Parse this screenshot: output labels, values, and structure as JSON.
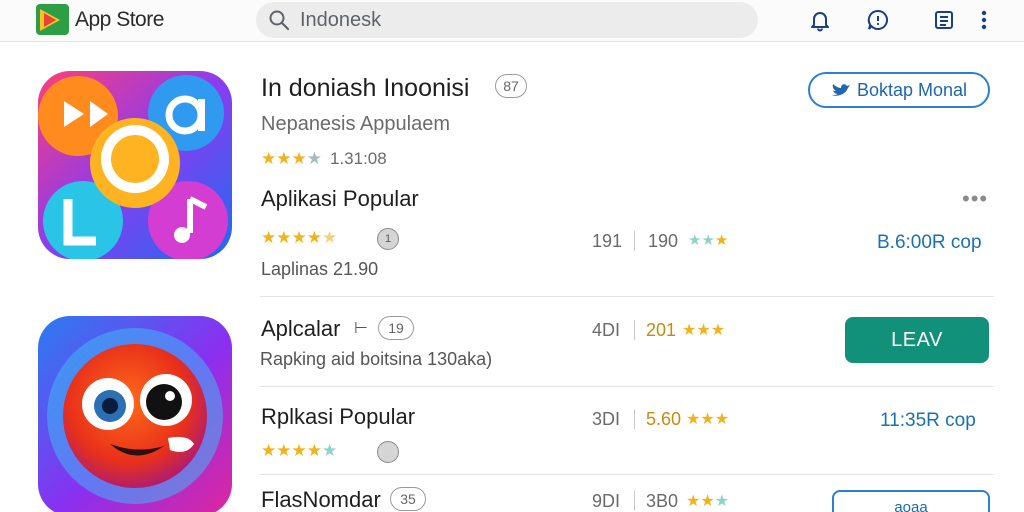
{
  "header": {
    "app_name": "App Store",
    "search_query": "Indonesk"
  },
  "featured": {
    "title": "In doniash Inoonisi",
    "title_badge": "87",
    "subtitle": "Nepanesis Appulaem",
    "rating_text": "1.31:08",
    "rating_stars": 3,
    "action_label": "Boktap Monal"
  },
  "section": {
    "heading": "Aplikasi Popular",
    "heading_badge": "1",
    "meta": "Laplinas 21.90",
    "col1": "191",
    "col2": "190",
    "price": "B.6:00R cop"
  },
  "list": [
    {
      "name": "Aplcalar",
      "badge": "19",
      "description": "Rapking aid boitsina 130aka)",
      "col1": "4DI",
      "col2": "201",
      "action_label": "LEAV"
    },
    {
      "name": "Rplkasi Popular",
      "description": "",
      "col1": "3DI",
      "col2": "5.60",
      "price": "11:35R cop"
    },
    {
      "name": "FlasNomdar",
      "badge": "35",
      "col1": "9DI",
      "col2": "3B0",
      "action_label": "aoaa"
    }
  ],
  "colors": {
    "accent": "#1a6fb5",
    "install_green": "#11907a",
    "star_gold": "#f2b21c"
  }
}
